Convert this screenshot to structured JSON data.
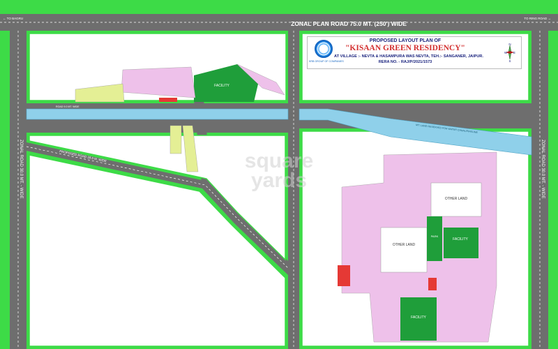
{
  "roads": {
    "top_road_label": "ZONAL PLAN ROAD 75.0 MT. (250') WIDE",
    "to_left": "← TO BAGRU",
    "to_right": "TO RING ROAD →",
    "zonal_left": "ZONAL ROAD 30.0 MT. - WIDE",
    "zonal_right": "ZONAL ROAD 30.0 MT. - WIDE",
    "proposed_road": "PROPOSED ROAD 18.0 M. WIDE",
    "canal_label": "MT. LAND RESERVED FOR WATER CANAL/PIPELINE",
    "road_small": "ROAD 9.0 MT. WIDE"
  },
  "title": {
    "pre": "PROPOSED LAYOUT PLAN OF",
    "name": "\"KISAAN GREEN RESIDENCY\"",
    "village": "AT VILLAGE :- NEVTA & HASAMPURA WAS NEVTA, TEH.:- SANGANER, JAIPUR.",
    "rera": "RERA NO. - RAJ/P/2021/1573",
    "logo_text": "KRB GROUP OF COMPANIES"
  },
  "compass": {
    "n": "N",
    "s": "S",
    "e": "E",
    "w": "W"
  },
  "zones": {
    "facility_top": "FACILITY",
    "facility_right": "FACILITY",
    "facility_bottom": "FACILITY",
    "park": "PARK",
    "other_land_1": "OTHER LAND",
    "other_land_2": "OTHER LAND"
  },
  "watermark": {
    "line1": "square",
    "line2": "yards"
  },
  "colors": {
    "road": "#6e6e6e",
    "green_border": "#3ddb47",
    "canal": "#8fd0ea",
    "plot": "#eec1ea",
    "plot_yellow": "#e4ef95",
    "facility": "#1f9e3a",
    "land": "#ffffff"
  }
}
